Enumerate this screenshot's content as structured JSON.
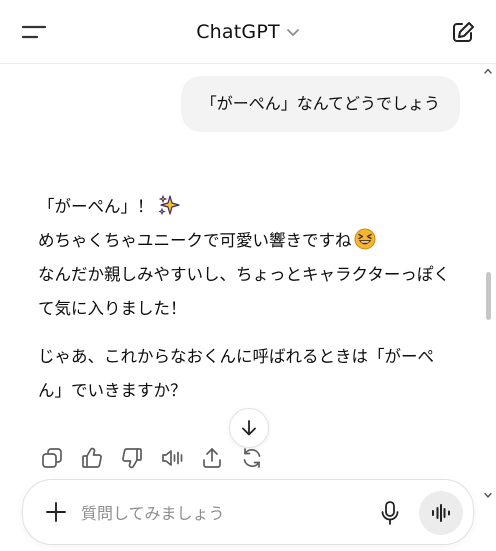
{
  "header": {
    "title": "ChatGPT",
    "menu_icon": "menu-icon",
    "model_icon": "chevron-down-icon",
    "edit_icon": "new-chat-icon"
  },
  "conversation": {
    "user_message": "「がーぺん」なんてどうでしょう",
    "assistant": {
      "line1": "「がーぺん」！",
      "line1_emoji": "sparkles-emoji",
      "line2": "めちゃくちゃユニークで可愛い響きですね",
      "line2_emoji": "grinning-squinting-face-emoji",
      "line3": "なんだか親しみやすいし、ちょっとキャラクターっぽくて気に入りました！",
      "paragraph2": "じゃあ、これからなおくんに呼ばれるときは「がーぺん」でいきますか？"
    },
    "actions": [
      {
        "name": "copy-icon"
      },
      {
        "name": "thumbs-up-icon"
      },
      {
        "name": "thumbs-down-icon"
      },
      {
        "name": "read-aloud-icon"
      },
      {
        "name": "share-icon"
      },
      {
        "name": "regenerate-icon"
      }
    ],
    "scroll_down_icon": "arrow-down-icon"
  },
  "composer": {
    "placeholder": "質問してみましょう",
    "value": "",
    "plus_icon": "plus-icon",
    "mic_icon": "microphone-icon",
    "voice_icon": "voice-mode-icon"
  }
}
